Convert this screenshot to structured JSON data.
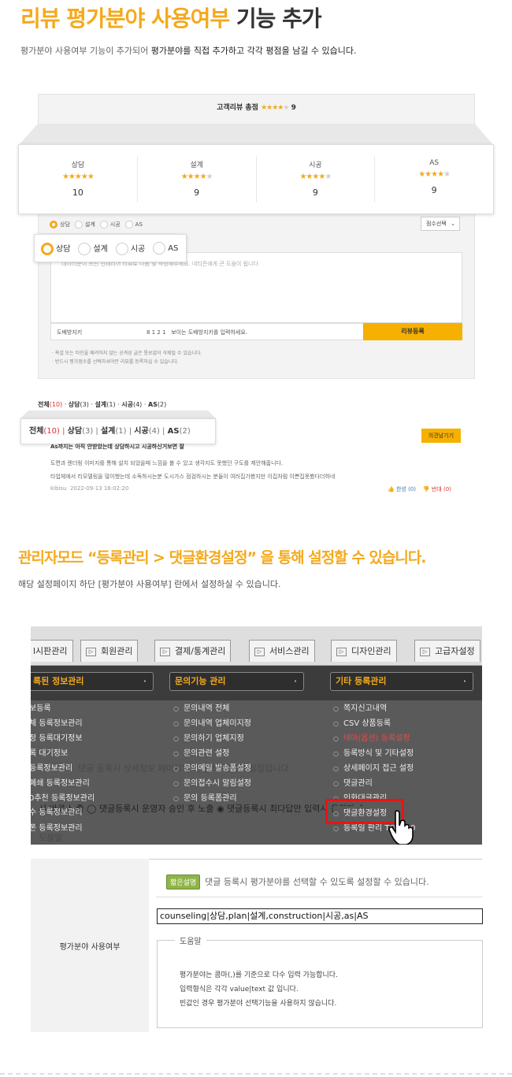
{
  "section1": {
    "title_orange": "리뷰 평가분야 사용여부",
    "title_dark": "기능 추가",
    "subtitle_pre": "평가분야 사용여부 기능이 추가되어 ",
    "subtitle_bold": "평가분야를 직접 추가하고 각각 평점을 남길 수 있습니다.",
    "summary_label": "고객리뷰 총점",
    "summary_score": "9",
    "bg_categories": [
      "상담",
      "설계",
      "시공",
      "AS"
    ],
    "scores": [
      {
        "label": "상담",
        "stars": 5,
        "value": "10"
      },
      {
        "label": "설계",
        "stars": 4,
        "value": "9"
      },
      {
        "label": "시공",
        "stars": 4,
        "value": "9"
      },
      {
        "label": "AS",
        "stars": 4,
        "value": "9"
      }
    ],
    "small_radios": [
      "상담",
      "설계",
      "시공",
      "AS"
    ],
    "sort_select": "점수선택",
    "radios": [
      "상담",
      "설계",
      "시공",
      "AS"
    ],
    "selected_radio": "상담",
    "textarea_hint": "데이터분이 쓰신 인테리어 리뷰로 다음 및 작성해주세요. 네티즌에게 큰 도움이 됩니다",
    "captcha_label": "도배방지키",
    "captcha_code": "8 1 2 1",
    "captcha_hint": "보이는 도배방지키를 입력하세요.",
    "submit": "리뷰등록",
    "notes": [
      "· 욕설 또는 타인을 배려하지 않는 공격성 글은 통보없이 삭제될 수 있습니다.",
      "· 반드시 평가점수를 선택하셔야만 리뷰를 등록하실 수 있습니다."
    ],
    "filter_small": {
      "all": "전체",
      "all_n": "(10)",
      "c1": "상담",
      "c1_n": "(3)",
      "c2": "설계",
      "c2_n": "(1)",
      "c3": "시공",
      "c3_n": "(4)",
      "c4": "AS",
      "c4_n": "(2)"
    },
    "filter": {
      "all": "전체",
      "all_n": "(10)",
      "c1": "상담",
      "c1_n": "(3)",
      "c2": "설계",
      "c2_n": "(1)",
      "c3": "시공",
      "c3_n": "(4)",
      "c4": "AS",
      "c4_n": "(2)"
    },
    "answer_btn": "의견남기기",
    "review_title": "As까지는 아직 안받았는데 상담하시고 시공하신거보면 잘",
    "review_body": [
      "도면과 렌더링 이미지를 통해 설치 되었을때 느낌을 볼 수 있고 생각지도 못했던 구도를 제안해줍니다.",
      "타업체에서 리모델링을 많이했는데 소독하시는분 도시가스 점검하시는 분들이 여러집가봤지만 이집처럼 이쁜집못봤다더하네"
    ],
    "review_author": "kibisu",
    "review_date": "2022-09-13 16:02:20",
    "vote_up": "찬성",
    "vote_up_n": "(0)",
    "vote_down": "반대",
    "vote_down_n": "(0)"
  },
  "section2": {
    "title": "관리자모드 “등록관리 > 댓글환경설정” 을 통해 설정할 수 있습니다.",
    "subtitle": "해당 설정페이지 하단 [평가분야 사용여부] 란에서 설정하실 수 있습니다.",
    "tabs": [
      "l시판관리",
      "회원관리",
      "결제/통계관리",
      "서비스관리",
      "디자인관리",
      "고급자설정"
    ],
    "menu_heads": [
      "록된 정보관리",
      "문의기능 관리",
      "기타 등록관리"
    ],
    "col1": [
      "보등록",
      "체 등록정보관리",
      "정 등록대기정보",
      "록 대기정보",
      "등록정보관리",
      "폐쇄 등록정보관리",
      "0추천 등록정보관리",
      "수 등록정보관리",
      "폰 등록정보관리"
    ],
    "col2": [
      "문의내역 전체",
      "문의내역 업체미지정",
      "문의하기 업체지정",
      "문의관련 설정",
      "문의메일 발송폼설정",
      "문의접수시 알림설정",
      "문의 등록폼관리"
    ],
    "col3": [
      "쪽지신고내역",
      "CSV 상품등록",
      "테마(옵션) 등록설정",
      "등록방식 및 기타설정",
      "상세페이지 접근 설정",
      "댓글관리",
      "인화대글관리",
      "댓글환경설정",
      "등록일 판리 TOP100"
    ],
    "ghost1": "댓글 등록시 상세정보 페이지의 다 방식에 대한 설정입니다",
    "ghost2": "시 바로 노출  ◯ 댓글등록시 운영자 승인 후 노출  ◉ 댓글등록시 최다답만 입력시 운영자 승",
    "ghost3": "도움말",
    "label": "평가분야 사용여부",
    "badge": "짧은설명",
    "hint": "댓글 등록시 평가분야를 선택할 수 있도록 설정할 수 있습니다.",
    "input_value": "counseling|상담,plan|설계,construction|시공,as|AS",
    "legend": "도움말",
    "help": [
      "평가분야는 콤마(,)를 기준으로 다수 입력 가능합니다.",
      "입력형식은 각각 value|text 값 입니다.",
      "빈값인 경우 평가분야 선택기능을 사용하지 않습니다."
    ]
  }
}
